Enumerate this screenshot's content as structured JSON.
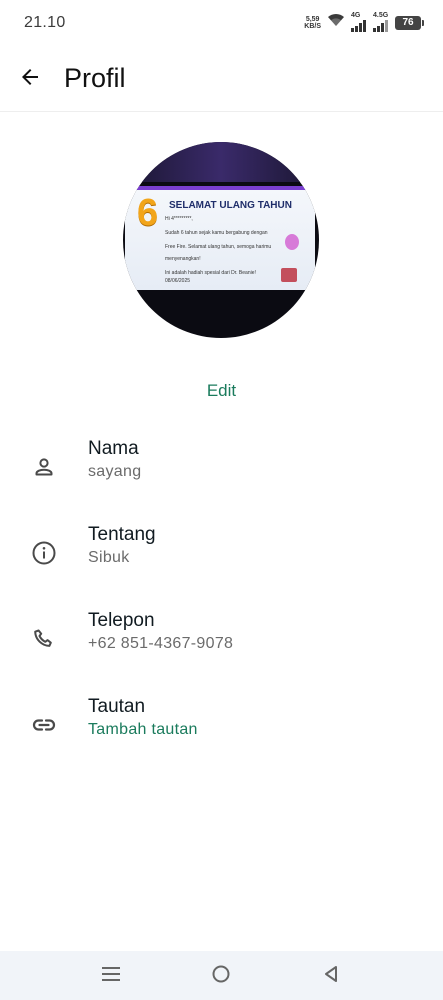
{
  "status_bar": {
    "time": "21.10",
    "net_speed_value": "5,59",
    "net_speed_unit": "KB/S",
    "signal_1_label": "4G",
    "signal_2_label": "4.5G",
    "battery": "76"
  },
  "app_bar": {
    "title": "Profil",
    "back_icon": "arrow-left-icon"
  },
  "avatar": {
    "card_number": "6",
    "card_title": "SELAMAT ULANG TAHUN",
    "card_lines": [
      "Hi 4*********,",
      "Sudah 6 tahun sejak kamu bergabung dengan",
      "Free Fire. Selamat ulang tahun, semoga harimu",
      "menyenangkan!",
      "Ini adalah hadiah spesial dari Dr. Beanie!",
      "08/06/2025"
    ]
  },
  "edit_label": "Edit",
  "rows": [
    {
      "icon": "person-icon",
      "label": "Nama",
      "value": "sayang"
    },
    {
      "icon": "info-icon",
      "label": "Tentang",
      "value": "Sibuk"
    },
    {
      "icon": "phone-icon",
      "label": "Telepon",
      "value": "+62 851-4367-9078"
    },
    {
      "icon": "link-icon",
      "label": "Tautan",
      "value": "Tambah tautan"
    }
  ],
  "nav_bar": {
    "recents_icon": "menu-icon",
    "home_icon": "home-circle-icon",
    "back_icon": "triangle-back-icon"
  },
  "colors": {
    "accent": "#1a7b5c",
    "text_primary": "#111b21",
    "text_secondary": "#6b6b6b",
    "icon": "#4a4a4a"
  }
}
